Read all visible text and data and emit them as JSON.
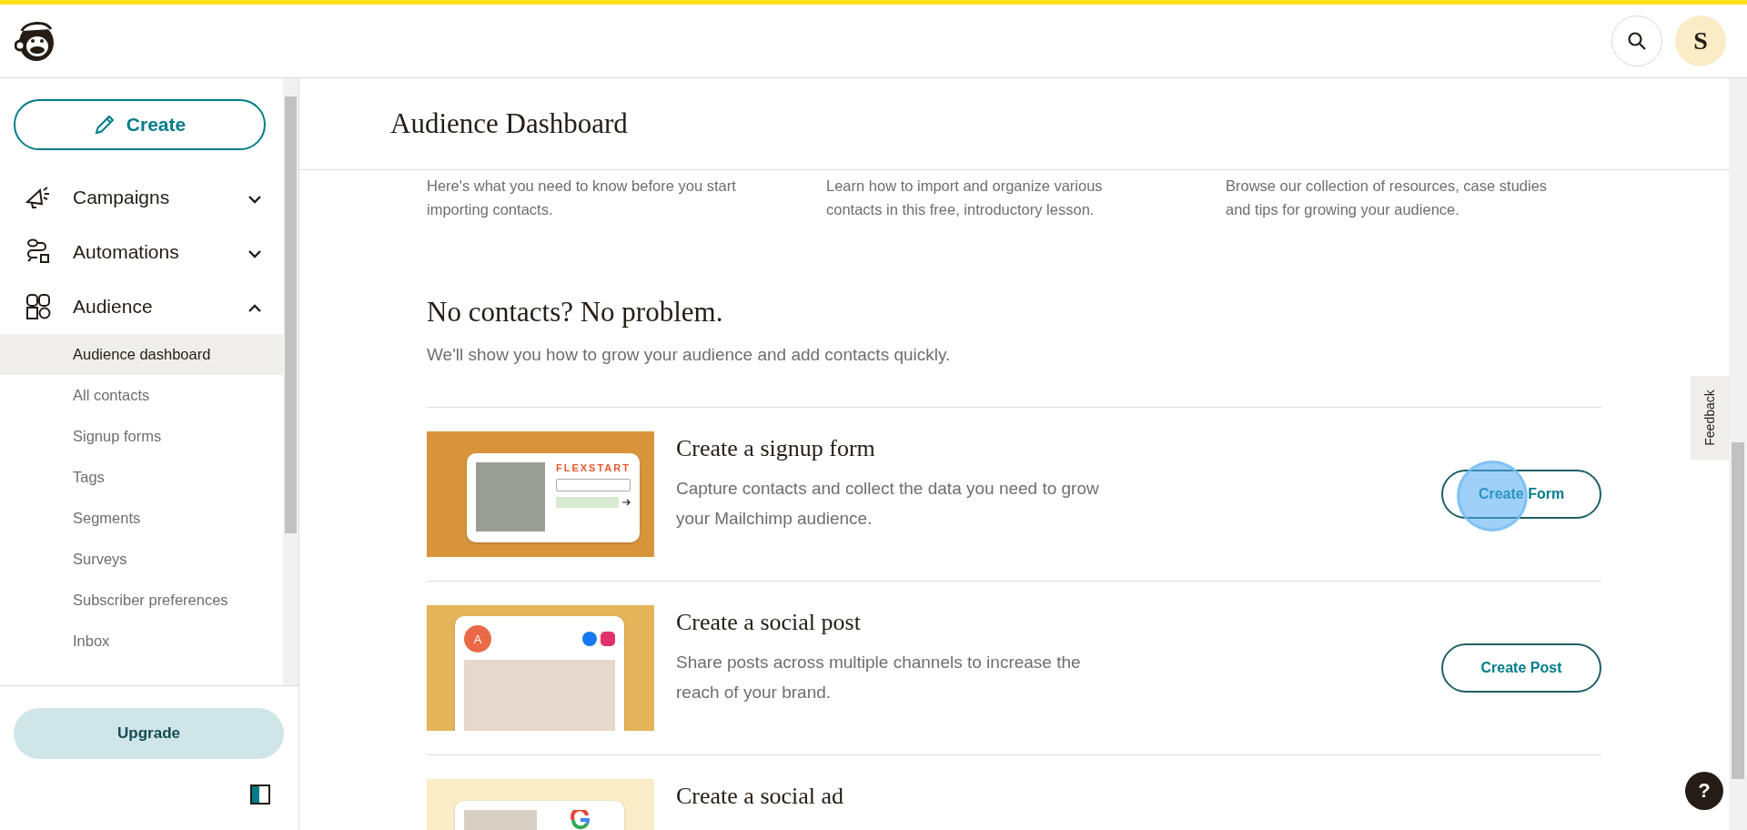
{
  "header": {
    "avatar_letter": "S"
  },
  "sidebar": {
    "create_label": "Create",
    "nav": [
      {
        "label": "Campaigns",
        "expanded": false
      },
      {
        "label": "Automations",
        "expanded": false
      },
      {
        "label": "Audience",
        "expanded": true,
        "children": [
          {
            "label": "Audience dashboard",
            "selected": true
          },
          {
            "label": "All contacts",
            "selected": false
          },
          {
            "label": "Signup forms",
            "selected": false
          },
          {
            "label": "Tags",
            "selected": false
          },
          {
            "label": "Segments",
            "selected": false
          },
          {
            "label": "Surveys",
            "selected": false
          },
          {
            "label": "Subscriber preferences",
            "selected": false
          },
          {
            "label": "Inbox",
            "selected": false
          }
        ]
      }
    ],
    "upgrade_label": "Upgrade"
  },
  "page": {
    "title": "Audience Dashboard",
    "resources": [
      {
        "description": "Here's what you need to know before you start importing contacts."
      },
      {
        "description": "Learn how to import and organize various contacts in this free, introductory lesson."
      },
      {
        "description": "Browse our collection of resources, case studies and tips for growing your audience."
      }
    ],
    "section": {
      "title": "No contacts? No problem.",
      "subtitle": "We'll show you how to grow your audience and add contacts quickly."
    },
    "items": [
      {
        "kind": "signup_form",
        "title": "Create a signup form",
        "description": "Capture contacts and collect the data you need to grow your Mailchimp audience.",
        "button": "Create Form",
        "art_text": "FLEXSTART"
      },
      {
        "kind": "social_post",
        "title": "Create a social post",
        "description": "Share posts across multiple channels to increase the reach of your brand.",
        "button": "Create Post",
        "art_text": "A"
      },
      {
        "kind": "social_ad",
        "title": "Create a social ad"
      }
    ]
  },
  "feedback_label": "Feedback",
  "help_label": "?"
}
